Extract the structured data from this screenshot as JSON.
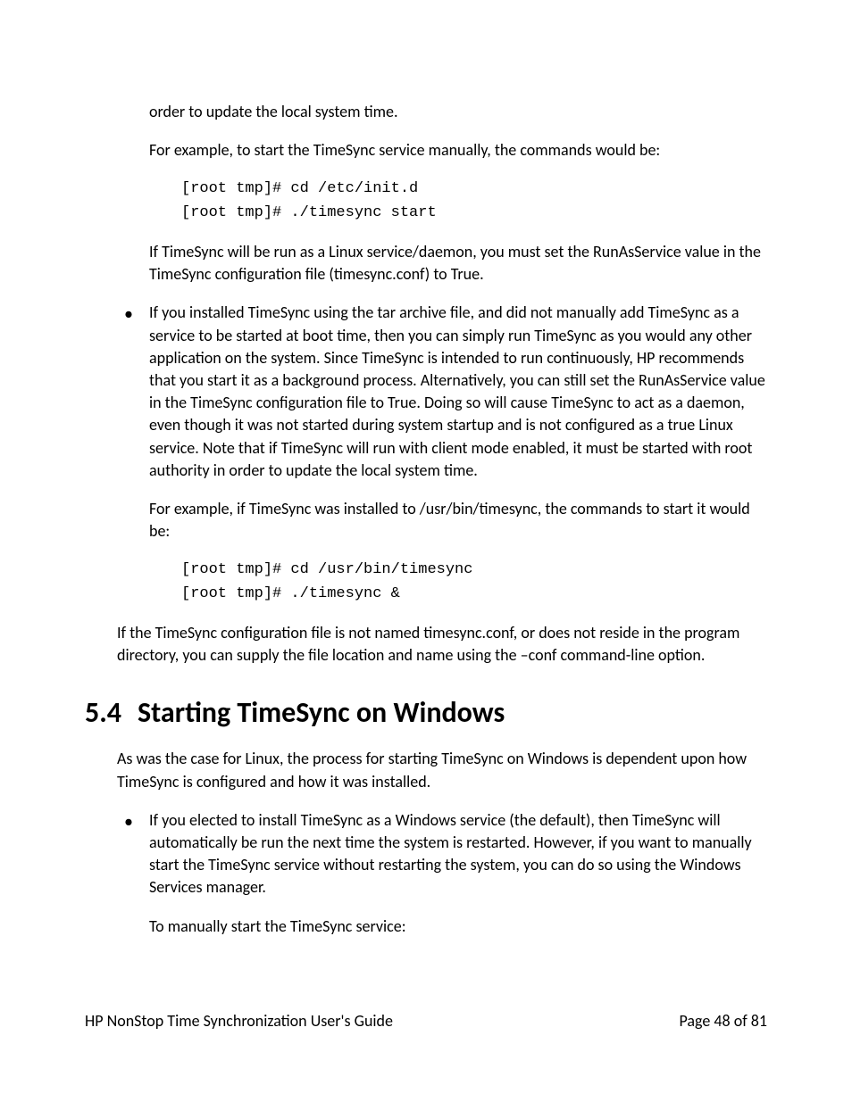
{
  "para1": "order to update the local system time.",
  "para2": "For example, to start the TimeSync service manually, the commands would be:",
  "code1_line1": "[root tmp]# cd /etc/init.d",
  "code1_line2": "[root tmp]# ./timesync start",
  "para3": "If TimeSync will be run as a Linux service/daemon, you must set the RunAsService value in the TimeSync configuration file (timesync.conf) to True.",
  "bullet1": "If you installed TimeSync using the tar archive file, and did not manually add TimeSync as a service to be started at boot time, then you can simply run TimeSync as you would any other application on the system.  Since TimeSync is intended to run continuously, HP recommends that you start it as a background process.  Alternatively, you can still set the RunAsService value in the TimeSync configuration file to True.  Doing so will cause TimeSync to act as a daemon, even though it was not started during system startup and is not configured as a true Linux service.  Note that if TimeSync will run with client mode enabled, it must be started with root authority in order to update the local system time.",
  "para4": "For example, if TimeSync was installed to /usr/bin/timesync, the commands to start it would be:",
  "code2_line1": "[root tmp]# cd /usr/bin/timesync",
  "code2_line2": "[root tmp]# ./timesync &",
  "para5": "If the TimeSync configuration file is not named timesync.conf, or does not reside in the program directory, you can supply the file location and name using the –conf command-line option.",
  "heading_num": "5.4",
  "heading_text": "Starting TimeSync on Windows",
  "para6": "As was the case for Linux, the process for starting TimeSync on Windows is dependent upon how TimeSync is configured and how it was installed.",
  "bullet2": "If you elected to install TimeSync as a Windows service (the default), then TimeSync will automatically be run the next time the system is restarted.  However, if you want to manually start the TimeSync service without restarting the system, you can do so using the Windows Services manager.",
  "para7": "To manually start the TimeSync service:",
  "footer_left": "HP NonStop Time Synchronization User's Guide",
  "footer_right": "Page 48 of 81"
}
